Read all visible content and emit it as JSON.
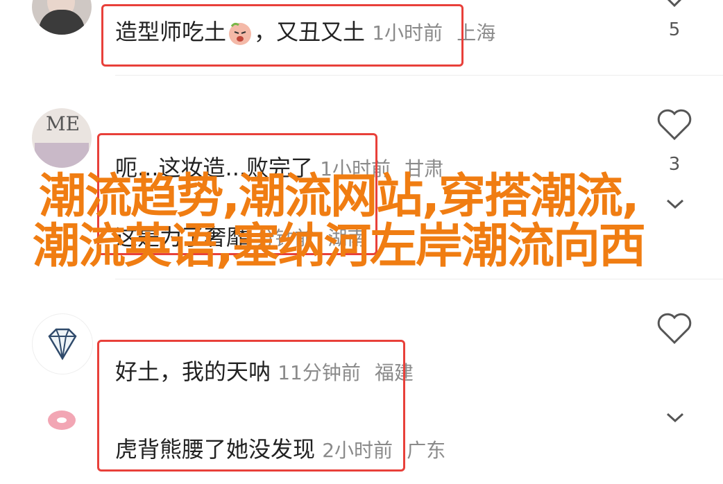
{
  "comments": [
    {
      "text": "造型师吃土",
      "emoji_icon": "crying-face-icon",
      "text2": "，又丑又土",
      "time": "1小时前",
      "location": "上海",
      "likes": "5"
    },
    {
      "text": "呃...这妆造...败完了",
      "time": "1小时前",
      "location": "甘肃",
      "likes": "3"
    },
    {
      "text": "这是为了奢靡",
      "time": "分钟前",
      "location": "湖南"
    },
    {
      "text": "好土，我的天呐",
      "time": "11分钟前",
      "location": "福建"
    },
    {
      "text": "虎背熊腰了她没发现",
      "time": "2小时前",
      "location": "广东"
    }
  ],
  "avatars": {
    "avatar2_text": "ME"
  },
  "overlay": {
    "title": "潮流趋势,潮流网站,穿搭潮流,潮流英语,塞纳河左岸潮流向西"
  },
  "colors": {
    "highlight_border": "#e8403a",
    "overlay_text": "#f07d12"
  }
}
